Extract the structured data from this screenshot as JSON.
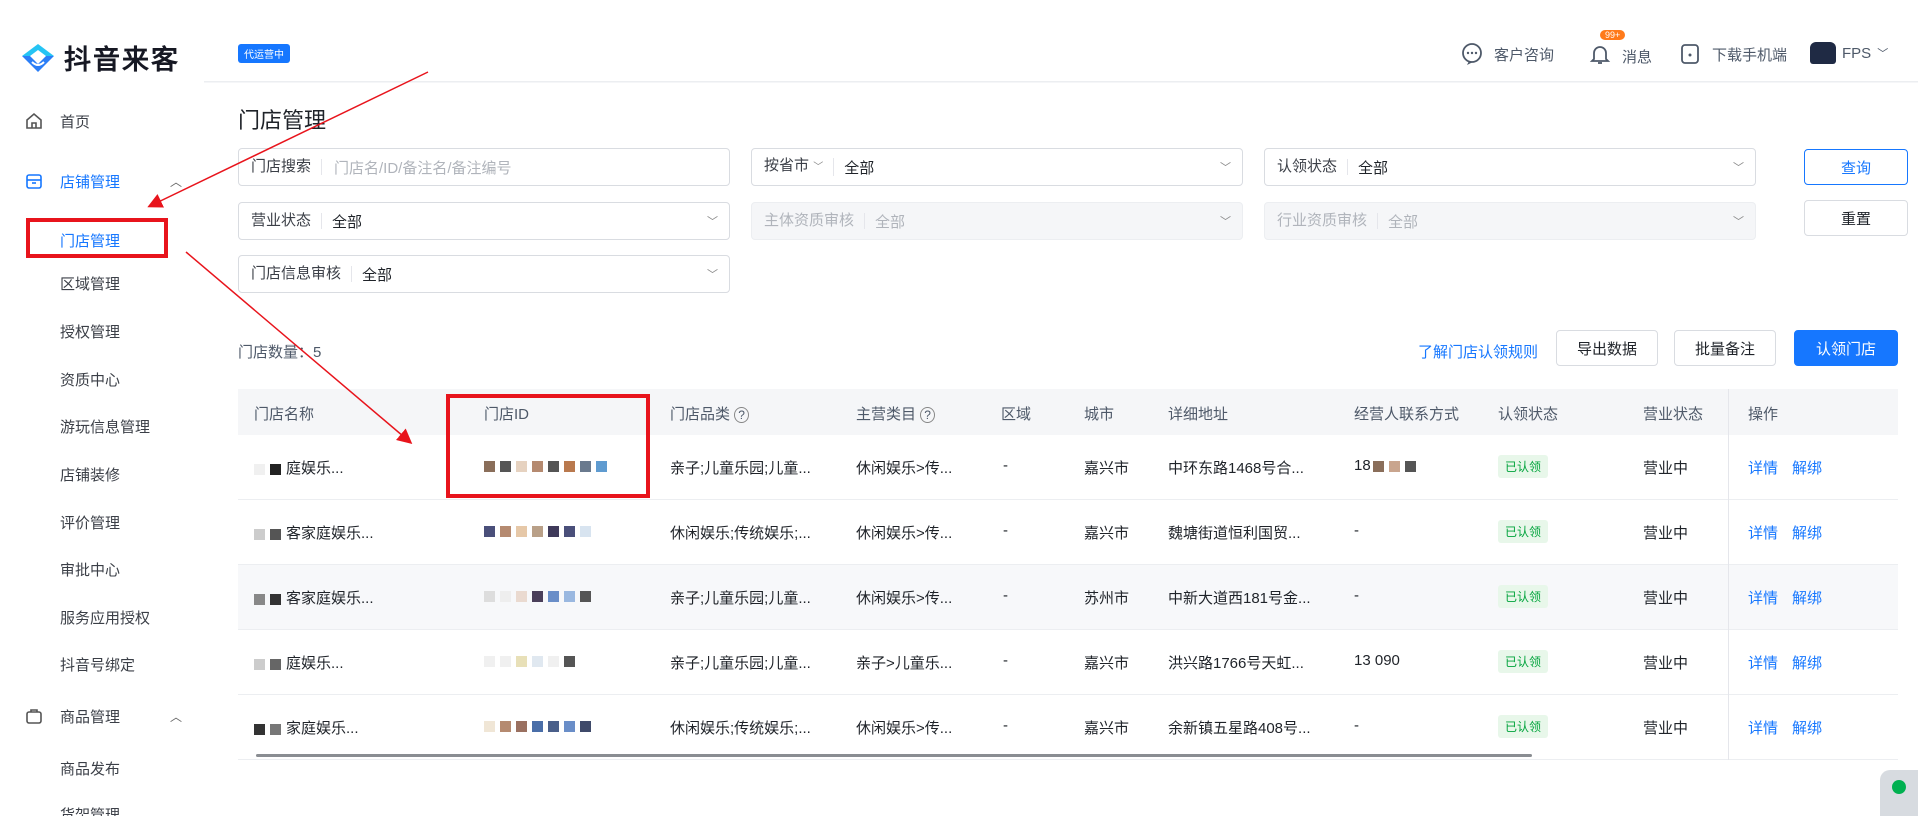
{
  "app": {
    "logo_text": "抖音来客",
    "ops_badge": "代运营中"
  },
  "sidebar": {
    "home": "首页",
    "store_group": "店铺管理",
    "store_items": [
      "门店管理",
      "区域管理",
      "授权管理",
      "资质中心",
      "游玩信息管理",
      "店铺装修",
      "评价管理",
      "审批中心",
      "服务应用授权",
      "抖音号绑定"
    ],
    "goods_group": "商品管理",
    "goods_items": [
      "商品发布",
      "货架管理"
    ]
  },
  "topbar": {
    "consult": "客户咨询",
    "message": "消息",
    "message_badge": "99+",
    "download": "下载手机端",
    "user": "FPS"
  },
  "page": {
    "title": "门店管理"
  },
  "filters": {
    "store_search_label": "门店搜索",
    "store_search_placeholder": "门店名/ID/备注名/备注编号",
    "region_label": "按省市",
    "region_value": "全部",
    "claim_label": "认领状态",
    "claim_value": "全部",
    "business_label": "营业状态",
    "business_value": "全部",
    "subject_label": "主体资质审核",
    "subject_value": "全部",
    "industry_label": "行业资质审核",
    "industry_value": "全部",
    "info_label": "门店信息审核",
    "info_value": "全部",
    "query_button": "查询",
    "reset_button": "重置"
  },
  "toolbar": {
    "count_text": "门店数量：5",
    "rules_link": "了解门店认领规则",
    "export_button": "导出数据",
    "batch_note_button": "批量备注",
    "claim_button": "认领门店"
  },
  "table": {
    "headers": [
      "门店名称",
      "门店ID",
      "门店品类",
      "主营类目",
      "区域",
      "城市",
      "详细地址",
      "经营人联系方式",
      "认领状态",
      "营业状态",
      "操作"
    ],
    "rows": [
      {
        "name": "庭娱乐...",
        "category": "亲子;儿童乐园;儿童...",
        "main": "休闲娱乐>传...",
        "area": "-",
        "city": "嘉兴市",
        "address": "中环东路1468号合...",
        "contact": "18",
        "claim": "已认领",
        "status": "营业中",
        "detail": "详情",
        "unbind": "解绑"
      },
      {
        "name": "客家庭娱乐...",
        "category": "休闲娱乐;传统娱乐;...",
        "main": "休闲娱乐>传...",
        "area": "-",
        "city": "嘉兴市",
        "address": "魏塘街道恒利国贸...",
        "contact": "-",
        "claim": "已认领",
        "status": "营业中",
        "detail": "详情",
        "unbind": "解绑"
      },
      {
        "name": "客家庭娱乐...",
        "category": "亲子;儿童乐园;儿童...",
        "main": "休闲娱乐>传...",
        "area": "-",
        "city": "苏州市",
        "address": "中新大道西181号金...",
        "contact": "-",
        "claim": "已认领",
        "status": "营业中",
        "detail": "详情",
        "unbind": "解绑"
      },
      {
        "name": "庭娱乐...",
        "category": "亲子;儿童乐园;儿童...",
        "main": "亲子>儿童乐...",
        "area": "-",
        "city": "嘉兴市",
        "address": "洪兴路1766号天虹...",
        "contact": "13 090",
        "claim": "已认领",
        "status": "营业中",
        "detail": "详情",
        "unbind": "解绑"
      },
      {
        "name": "家庭娱乐...",
        "category": "休闲娱乐;传统娱乐;...",
        "main": "休闲娱乐>传...",
        "area": "-",
        "city": "嘉兴市",
        "address": "余新镇五星路408号...",
        "contact": "-",
        "claim": "已认领",
        "status": "营业中",
        "detail": "详情",
        "unbind": "解绑"
      }
    ]
  },
  "colors": {
    "accent": "#1677ff",
    "annotation": "#e8141c",
    "claimed_tag": "#00a33b"
  }
}
